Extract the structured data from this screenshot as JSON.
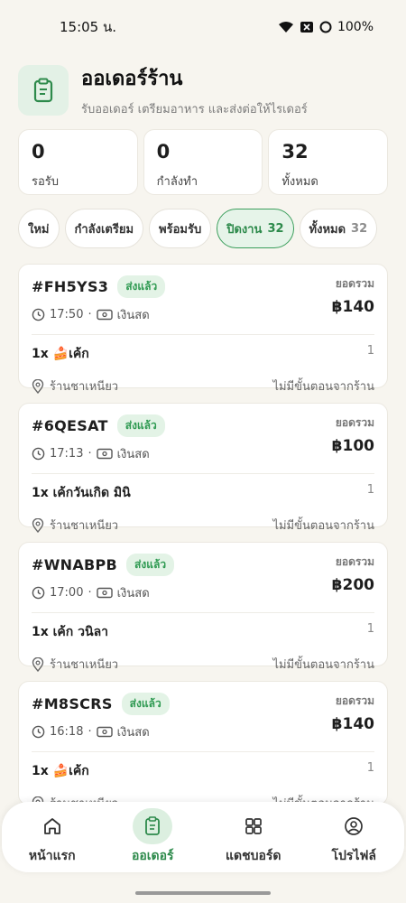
{
  "status_bar": {
    "time": "15:05 น.",
    "battery": "100%"
  },
  "header": {
    "title": "ออเดอร์ร้าน",
    "subtitle": "รับออเดอร์ เตรียมอาหาร และส่งต่อให้ไรเดอร์"
  },
  "stats": [
    {
      "value": "0",
      "label": "รอรับ"
    },
    {
      "value": "0",
      "label": "กำลังทำ"
    },
    {
      "value": "32",
      "label": "ทั้งหมด"
    }
  ],
  "tabs": [
    {
      "label": "ใหม่",
      "count": ""
    },
    {
      "label": "กำลังเตรียม",
      "count": ""
    },
    {
      "label": "พร้อมรับ",
      "count": ""
    },
    {
      "label": "ปิดงาน",
      "count": "32"
    },
    {
      "label": "ทั้งหมด",
      "count": "32"
    }
  ],
  "active_tab": "ปิดงาน",
  "orders": [
    {
      "id": "#FH5YS3",
      "status": "ส่งแล้ว",
      "time": "17:50",
      "payment": "เงินสด",
      "total_label": "ยอดรวม",
      "total": "฿140",
      "item": "1x 🍰เค้ก",
      "item_qty": "1",
      "shop": "ร้านชาเหนียว",
      "pickup_note": "ไม่มีขั้นตอนจากร้าน"
    },
    {
      "id": "#6QESAT",
      "status": "ส่งแล้ว",
      "time": "17:13",
      "payment": "เงินสด",
      "total_label": "ยอดรวม",
      "total": "฿100",
      "item": "1x เค้กวันเกิด มินิ",
      "item_qty": "1",
      "shop": "ร้านชาเหนียว",
      "pickup_note": "ไม่มีขั้นตอนจากร้าน"
    },
    {
      "id": "#WNABPB",
      "status": "ส่งแล้ว",
      "time": "17:00",
      "payment": "เงินสด",
      "total_label": "ยอดรวม",
      "total": "฿200",
      "item": "1x เค้ก วนิลา",
      "item_qty": "1",
      "shop": "ร้านชาเหนียว",
      "pickup_note": "ไม่มีขั้นตอนจากร้าน"
    },
    {
      "id": "#M8SCRS",
      "status": "ส่งแล้ว",
      "time": "16:18",
      "payment": "เงินสด",
      "total_label": "ยอดรวม",
      "total": "฿140",
      "item": "1x 🍰เค้ก",
      "item_qty": "1",
      "shop": "ร้านชาเหนียว",
      "pickup_note": "ไม่มีขั้นตอนจากร้าน"
    }
  ],
  "nav": [
    {
      "label": "หน้าแรก",
      "icon": "home-icon"
    },
    {
      "label": "ออเดอร์",
      "icon": "clipboard-icon"
    },
    {
      "label": "แดชบอร์ด",
      "icon": "dashboard-icon"
    },
    {
      "label": "โปรไฟล์",
      "icon": "profile-icon"
    }
  ],
  "colors": {
    "accent": "#2d8a4b",
    "background": "#f7f5ef",
    "badge_bg": "#e3f3e6"
  }
}
